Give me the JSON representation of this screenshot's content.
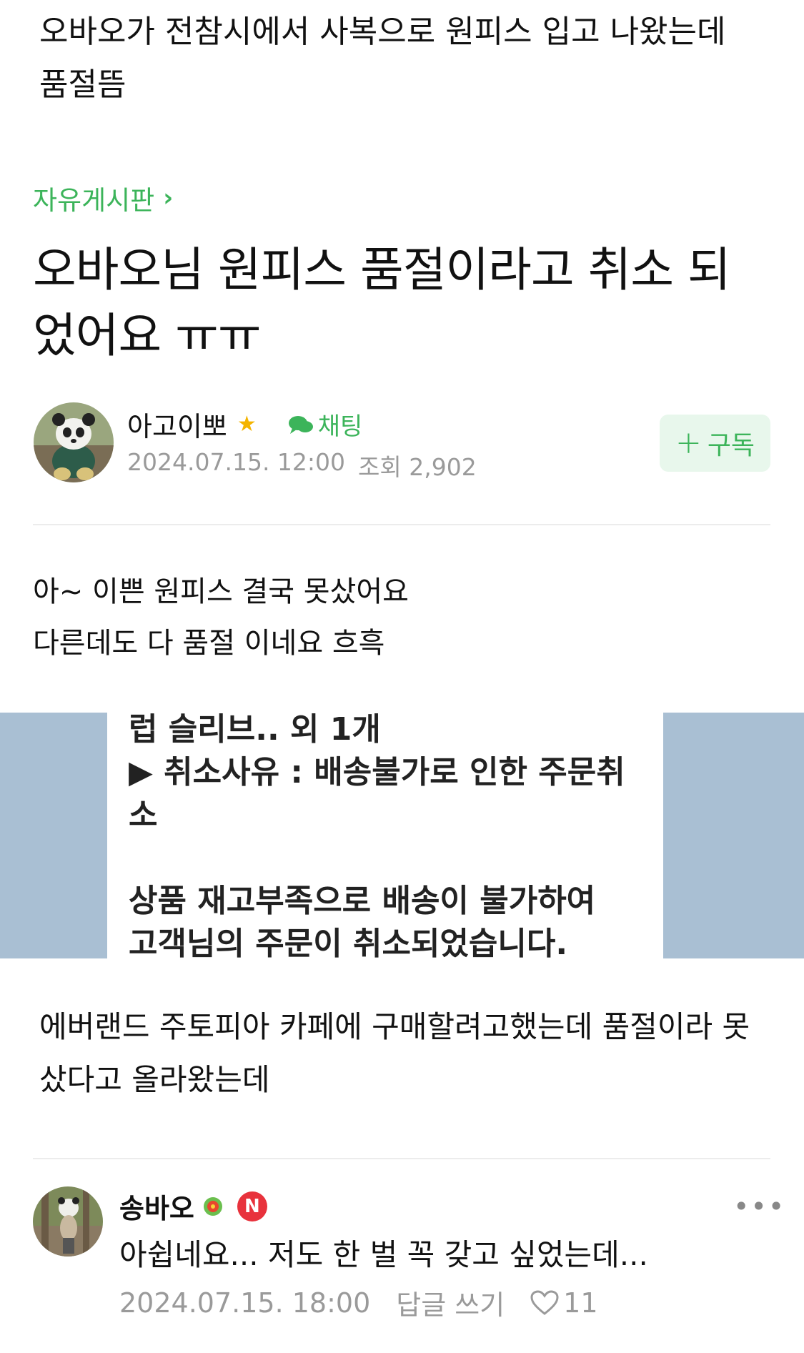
{
  "post_headline": "오바오가 전참시에서 사복으로 원피스 입고 나왔는데 품절뜸",
  "board": {
    "name": "자유게시판",
    "chevron": "›"
  },
  "title": "오바오님 원피스 품절이라고 취소 되었어요 ㅠㅠ",
  "author": {
    "name": "아고이뽀",
    "star": "★",
    "chat_label": "채팅",
    "date": "2024.07.15. 12:00",
    "views": "조회 2,902"
  },
  "subscribe": {
    "plus": "+",
    "label": "구독"
  },
  "body": {
    "line1": "아~ 이쁜 원피스 결국 못샀어요",
    "line2": "다른데도 다 품절 이네요 흐흑"
  },
  "embedded_image": {
    "line1": "럽 슬리브.. 외 1개",
    "line2": "▶ 취소사유 : 배송불가로 인한 주문취소",
    "line3": "상품 재고부족으로 배송이 불가하여",
    "line4": "고객님의 주문이 취소되었습니다."
  },
  "caption": "에버랜드 주토피아 카페에 구매할려고했는데 품절이라 못샀다고 올라왔는데",
  "comment": {
    "author": "송바오",
    "n_badge": "N",
    "more": "•••",
    "text": "아쉽네요... 저도 한 벌 꼭 갖고 싶었는데...",
    "date": "2024.07.15. 18:00",
    "reply_label": "답글 쓰기",
    "likes": "11"
  },
  "colors": {
    "accent_green": "#3cb45a",
    "muted_gray": "#9a9a9a",
    "image_side_bg": "#a9bfd3"
  }
}
